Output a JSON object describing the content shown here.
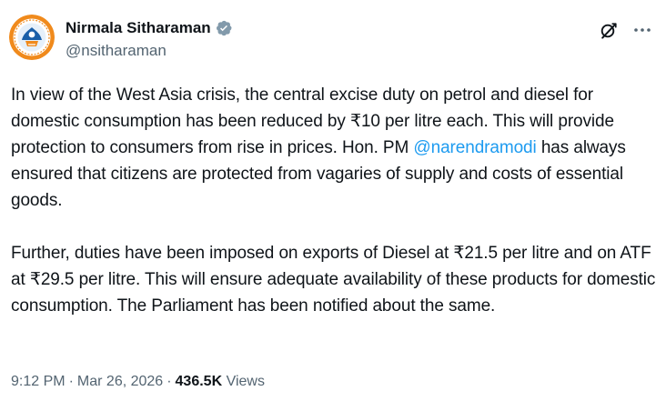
{
  "author": {
    "display_name": "Nirmala Sitharaman",
    "handle": "@nsitharaman",
    "verified_badge": "verified-badge-icon",
    "verified_color": "#829aab"
  },
  "body": {
    "p1_before": "In view of the West Asia crisis, the central excise duty on petrol and diesel for domestic consumption has been reduced by ₹10 per litre each. This will provide protection to consumers from rise in prices. Hon. PM ",
    "mention": "@narendramodi",
    "p1_after": " has always ensured that citizens are protected from vagaries of supply and costs of essential goods.",
    "p2": "Further, duties have been imposed on exports of Diesel at ₹21.5 per litre and on ATF at ₹29.5 per litre. This will ensure adequate availability of these products for domestic consumption. The Parliament has been notified about the same."
  },
  "meta": {
    "time": "9:12 PM",
    "date": "Mar 26, 2026",
    "separator": "·",
    "views_count": "436.5K",
    "views_label": "Views"
  },
  "icons": {
    "grok": "grok-icon",
    "more": "more-icon"
  },
  "colors": {
    "text_primary": "#0f1419",
    "text_secondary": "#536471",
    "link": "#1d9bf0"
  }
}
